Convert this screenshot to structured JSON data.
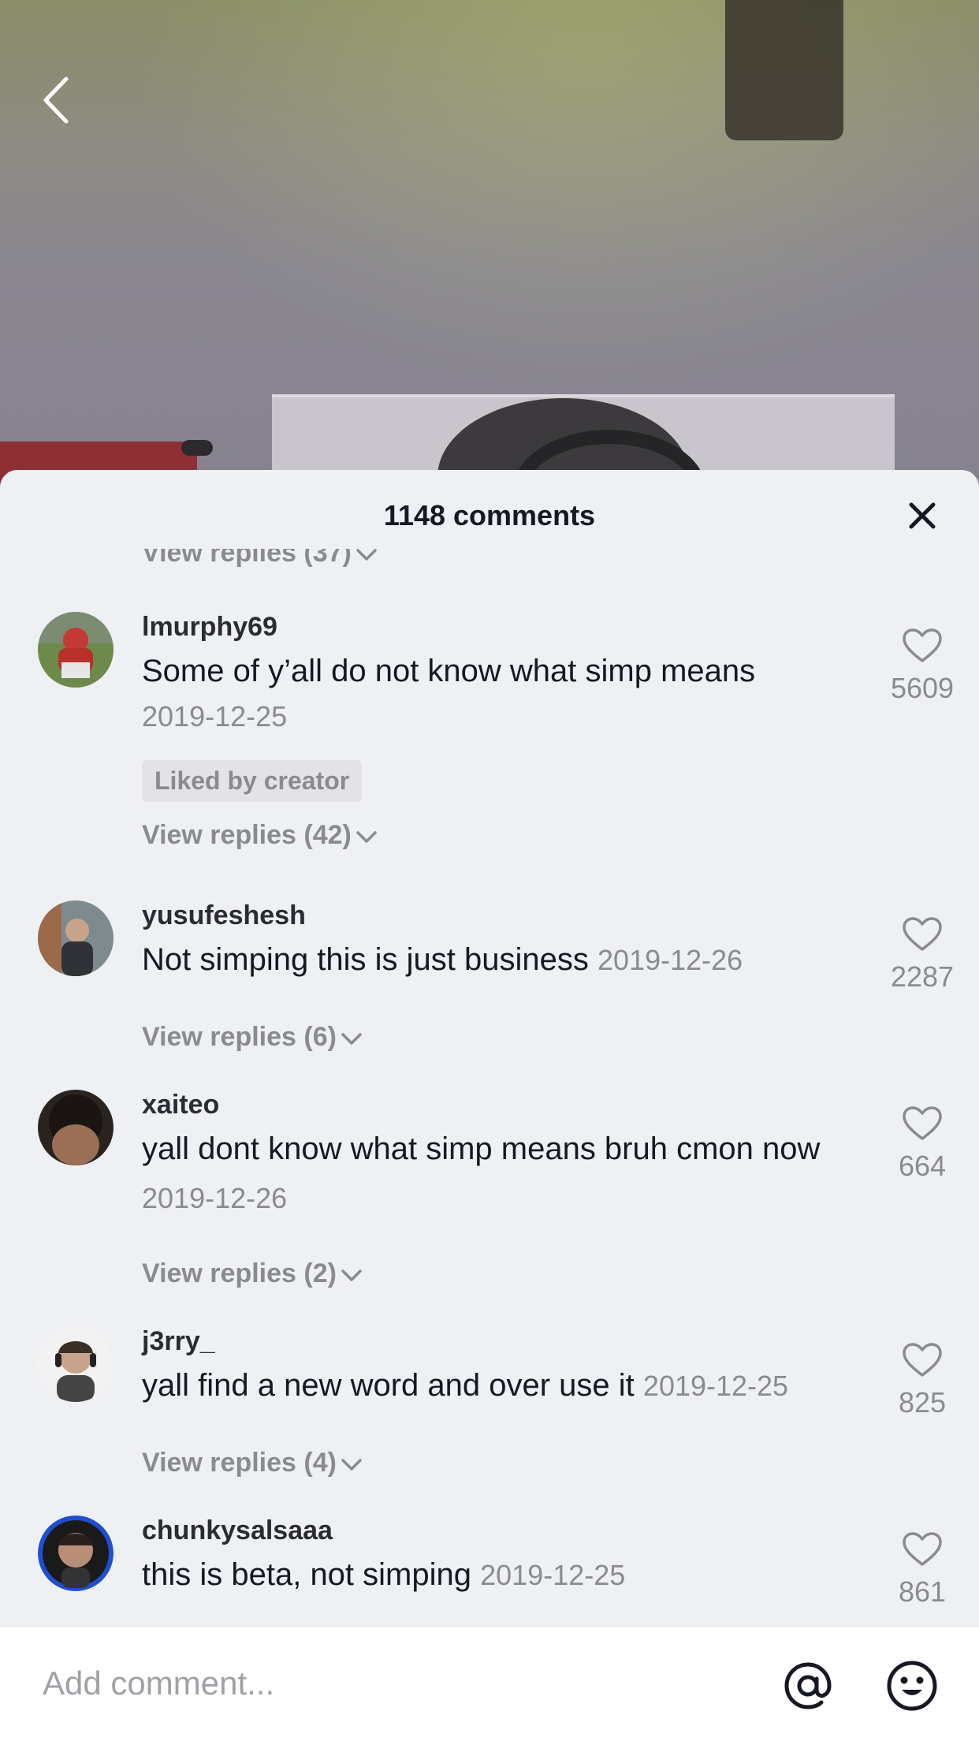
{
  "header": {
    "title": "1148 comments"
  },
  "icons": {
    "back": "chevron-left-icon",
    "close": "close-icon",
    "like": "heart-outline-icon",
    "mention": "at-sign-icon",
    "emoji": "smiley-icon"
  },
  "top_partial_replies": "View replies (37)",
  "comments": [
    {
      "username": "lmurphy69",
      "text": "Some of y’all do not know what simp means",
      "date": "2019-12-25",
      "badge": "Liked by creator",
      "likes": "5609",
      "replies": "View replies (42)"
    },
    {
      "username": "yusufeshesh",
      "text": "Not simping this is just business",
      "date": "2019-12-26",
      "likes": "2287",
      "replies": "View replies (6)"
    },
    {
      "username": "xaiteo",
      "text": "yall dont know what simp means bruh cmon now",
      "date": "2019-12-26",
      "likes": "664",
      "replies": "View replies (2)"
    },
    {
      "username": "j3rry_",
      "text": "yall find a new word and over use it",
      "date": "2019-12-25",
      "likes": "825",
      "replies": "View replies (4)"
    },
    {
      "username": "chunkysalsaaa",
      "text": "this is beta, not simping",
      "date": "2019-12-25",
      "likes": "861"
    }
  ],
  "input": {
    "placeholder": "Add comment..."
  },
  "colors": {
    "sheet_bg": "#eef0f3",
    "text_primary": "#161823",
    "text_secondary": "#8a8b91"
  }
}
